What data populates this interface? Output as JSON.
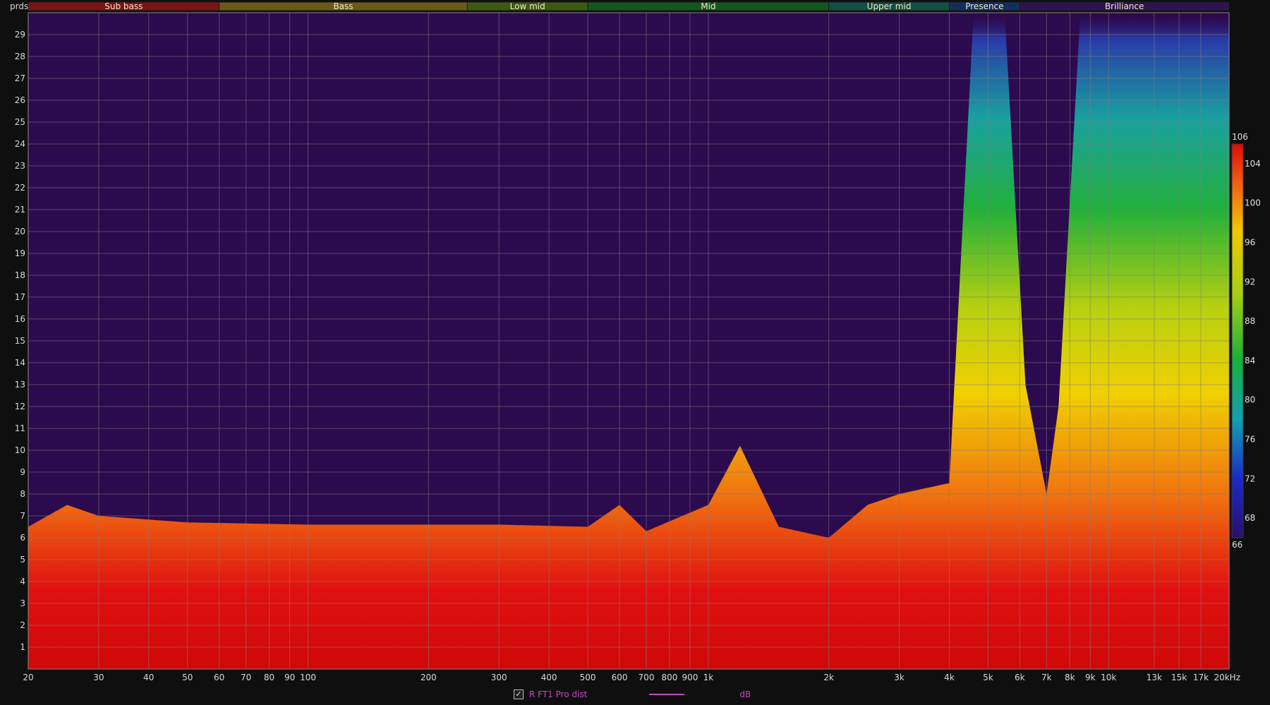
{
  "chart_data": {
    "type": "heatmap",
    "title": "",
    "y_unit_label": "prds",
    "x_unit_label": "20kHz",
    "x_scale": "log",
    "x_range_hz": [
      20,
      20000
    ],
    "y_range_periods": [
      0,
      30
    ],
    "x_ticks": [
      {
        "v": 20,
        "label": "20"
      },
      {
        "v": 30,
        "label": "30"
      },
      {
        "v": 40,
        "label": "40"
      },
      {
        "v": 50,
        "label": "50"
      },
      {
        "v": 60,
        "label": "60"
      },
      {
        "v": 70,
        "label": "70"
      },
      {
        "v": 80,
        "label": "80"
      },
      {
        "v": 90,
        "label": "90"
      },
      {
        "v": 100,
        "label": "100"
      },
      {
        "v": 200,
        "label": "200"
      },
      {
        "v": 300,
        "label": "300"
      },
      {
        "v": 400,
        "label": "400"
      },
      {
        "v": 500,
        "label": "500"
      },
      {
        "v": 600,
        "label": "600"
      },
      {
        "v": 700,
        "label": "700"
      },
      {
        "v": 800,
        "label": "800"
      },
      {
        "v": 900,
        "label": "900"
      },
      {
        "v": 1000,
        "label": "1k"
      },
      {
        "v": 2000,
        "label": "2k"
      },
      {
        "v": 3000,
        "label": "3k"
      },
      {
        "v": 4000,
        "label": "4k"
      },
      {
        "v": 5000,
        "label": "5k"
      },
      {
        "v": 6000,
        "label": "6k"
      },
      {
        "v": 7000,
        "label": "7k"
      },
      {
        "v": 8000,
        "label": "8k"
      },
      {
        "v": 9000,
        "label": "9k"
      },
      {
        "v": 10000,
        "label": "10k"
      },
      {
        "v": 13000,
        "label": "13k"
      },
      {
        "v": 15000,
        "label": "15k"
      },
      {
        "v": 17000,
        "label": "17k"
      },
      {
        "v": 20000,
        "label": "20kHz"
      }
    ],
    "y_ticks": [
      1,
      2,
      3,
      4,
      5,
      6,
      7,
      8,
      9,
      10,
      11,
      12,
      13,
      14,
      15,
      16,
      17,
      18,
      19,
      20,
      21,
      22,
      23,
      24,
      25,
      26,
      27,
      28,
      29
    ],
    "bands": [
      {
        "label": "Sub bass",
        "from": 20,
        "to": 60,
        "color": "#7a1414"
      },
      {
        "label": "Bass",
        "from": 60,
        "to": 250,
        "color": "#6b5a16"
      },
      {
        "label": "Low mid",
        "from": 250,
        "to": 500,
        "color": "#3c5a12"
      },
      {
        "label": "Mid",
        "from": 500,
        "to": 2000,
        "color": "#12581c"
      },
      {
        "label": "Upper mid",
        "from": 2000,
        "to": 4000,
        "color": "#124f44"
      },
      {
        "label": "Presence",
        "from": 4000,
        "to": 6000,
        "color": "#12305a"
      },
      {
        "label": "Brilliance",
        "from": 6000,
        "to": 20000,
        "color": "#2e1550"
      }
    ],
    "colorbar": {
      "min": 66,
      "max": 106,
      "ticks": [
        66,
        68,
        72,
        76,
        80,
        84,
        88,
        92,
        96,
        100,
        104,
        106
      ]
    },
    "decay_profile": [
      {
        "hz": 20,
        "periods": 6.5
      },
      {
        "hz": 25,
        "periods": 7.5
      },
      {
        "hz": 30,
        "periods": 7.0
      },
      {
        "hz": 50,
        "periods": 6.7
      },
      {
        "hz": 100,
        "periods": 6.6
      },
      {
        "hz": 300,
        "periods": 6.6
      },
      {
        "hz": 500,
        "periods": 6.5
      },
      {
        "hz": 600,
        "periods": 7.5
      },
      {
        "hz": 700,
        "periods": 6.3
      },
      {
        "hz": 1000,
        "periods": 7.5
      },
      {
        "hz": 1200,
        "periods": 10.2
      },
      {
        "hz": 1500,
        "periods": 6.5
      },
      {
        "hz": 2000,
        "periods": 6.0
      },
      {
        "hz": 2500,
        "periods": 7.5
      },
      {
        "hz": 3000,
        "periods": 8.0
      },
      {
        "hz": 4000,
        "periods": 8.5
      },
      {
        "hz": 4600,
        "periods": 30
      },
      {
        "hz": 5500,
        "periods": 30
      },
      {
        "hz": 6200,
        "periods": 13
      },
      {
        "hz": 7000,
        "periods": 8
      },
      {
        "hz": 7500,
        "periods": 12
      },
      {
        "hz": 8500,
        "periods": 30
      },
      {
        "hz": 20000,
        "periods": 30
      }
    ],
    "legend": {
      "checked": true,
      "check_glyph": "✓",
      "series": "R FT1 Pro dist",
      "unit": "dB"
    }
  },
  "colors": {
    "background": "#2c0a4e",
    "line": "#c447c4"
  }
}
